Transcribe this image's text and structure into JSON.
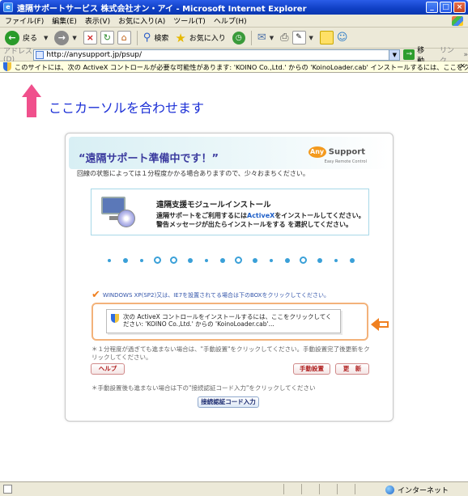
{
  "window": {
    "title": "遠隔サポートサービス  株式会社オン・アイ - Microsoft Internet Explorer",
    "minimize": "_",
    "maximize": "□",
    "close": "×"
  },
  "menu": [
    "ファイル(F)",
    "編集(E)",
    "表示(V)",
    "お気に入り(A)",
    "ツール(T)",
    "ヘルプ(H)"
  ],
  "toolbar": {
    "back": "戻る",
    "search": "検索",
    "favorites": "お気に入り"
  },
  "address": {
    "label": "アドレス(D)",
    "url": "http://anysupport.jp/psup/",
    "go": "移動",
    "links": "リンク"
  },
  "infobar": {
    "text": "このサイトには、次の ActiveX コントロールが必要な可能性があります: 'KOINO Co.,Ltd.' からの 'KoinoLoader.cab' インストールするには、ここをクリックしてください...",
    "close": "×"
  },
  "hint": {
    "text": "ここカーソルを合わせます",
    "arrow_color": "#f0508c"
  },
  "panel": {
    "title": "“遠隔サポート準備中です！”",
    "logo_mark": "Any",
    "logo_text": "Support",
    "logo_sub": "Easy Remote Control",
    "wait_text": "回線の状態によっては１分程度かかる場合ありますので、少々おまちください。",
    "module": {
      "title": "遠隔支援モジュールインストール",
      "desc1_before": "遠隔サポートをご利用するには",
      "desc1_highlight": "ActiveX",
      "desc1_after": "をインストールしてください。",
      "desc2": "警告メッセージが出たらインストールをする を選択してください。"
    },
    "check_text": "WINDOWS XP(SP2)又は、IE7を設置されてる場合は下のBOXをクリックしてください。",
    "install_box_text": "次の ActiveX コントロールをインストールするには、ここをクリックしてください: 'KOINO Co.,Ltd.' からの 'KoinoLoader.cab'...",
    "note1": "＊１分程度が過ぎても進まない場合は、\"手動設置\"をクリックしてください。手動設置完了後更新をクリックしてください。",
    "help_button": "ヘルプ",
    "manual_button": "手動設置",
    "refresh_button": "更　新",
    "note2": "＊手動設置後も進まない場合は下の\"接続認証コード入力\"をクリックしてください",
    "auth_button": "接続認証コード入力"
  },
  "progress": {
    "total_dots": 16,
    "active_index": 3
  },
  "status": {
    "zone": "インターネット"
  }
}
